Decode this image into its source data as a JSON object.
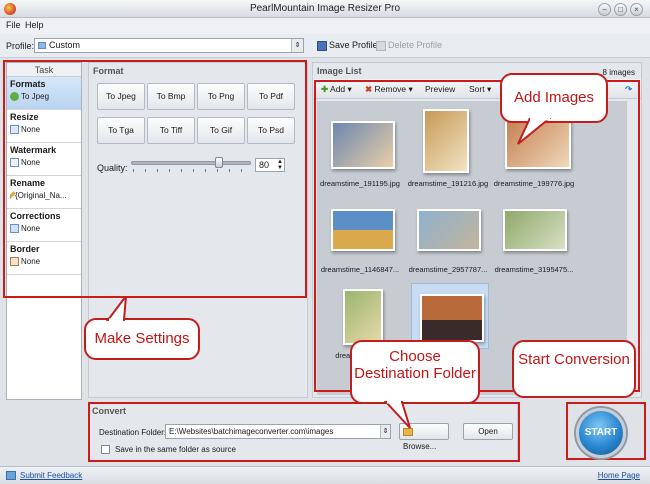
{
  "window": {
    "title": "PearlMountain Image Resizer Pro",
    "min": "–",
    "max": "□",
    "close": "×"
  },
  "menu": [
    "File",
    "Help"
  ],
  "profile": {
    "label": "Profile:",
    "value": "Custom",
    "save": "Save Profile",
    "delete": "Delete Profile"
  },
  "tasks": {
    "header": "Task",
    "items": [
      {
        "label": "Formats",
        "value": "To Jpeg"
      },
      {
        "label": "Resize",
        "value": "None"
      },
      {
        "label": "Watermark",
        "value": "None"
      },
      {
        "label": "Rename",
        "value": "{Original_Na..."
      },
      {
        "label": "Corrections",
        "value": "None"
      },
      {
        "label": "Border",
        "value": "None"
      }
    ]
  },
  "format": {
    "title": "Format",
    "buttons": [
      "To Jpeg",
      "To Bmp",
      "To Png",
      "To Pdf",
      "To Tga",
      "To Tiff",
      "To Gif",
      "To Psd"
    ],
    "quality_label": "Quality:",
    "quality_value": "80"
  },
  "image_list": {
    "title": "Image List",
    "count": "8 images",
    "add": "Add",
    "remove": "Remove",
    "preview": "Preview",
    "sort": "Sort",
    "images": [
      {
        "name": "dreamstime_191195.jpg",
        "colors": [
          "#6d86b0",
          "#e9cfa9"
        ]
      },
      {
        "name": "dreamstime_191216.jpg",
        "colors": [
          "#c99a57",
          "#f1e3c3"
        ]
      },
      {
        "name": "dreamstime_199776.jpg",
        "colors": [
          "#c27b4c",
          "#efd8b8"
        ]
      },
      {
        "name": "dreamstime_1146847...",
        "colors": [
          "#5c8fc8",
          "#d9a94b"
        ]
      },
      {
        "name": "dreamstime_2957787...",
        "colors": [
          "#8fb1d0",
          "#c2b49a"
        ]
      },
      {
        "name": "dreamstime_3195475...",
        "colors": [
          "#8fa86a",
          "#d7e0c3"
        ]
      },
      {
        "name": "dreamstime_...",
        "colors": [
          "#9bb56f",
          "#e6d9a8"
        ]
      },
      {
        "name": "",
        "colors": [
          "#b86a3a",
          "#3a2a2a"
        ]
      }
    ]
  },
  "convert": {
    "title": "Convert",
    "dest_label": "Destination Folder:",
    "dest_value": "E:\\Websites\\batchimageconverter.com\\images",
    "browse": "Browse...",
    "open": "Open",
    "same_folder": "Save in the same folder as source"
  },
  "start": "START",
  "status": {
    "feedback": "Submit Feedback",
    "homepage": "Home Page"
  },
  "callouts": {
    "add_images": "Add Images",
    "make_settings": "Make Settings",
    "destination": "Choose Destination Folder",
    "start": "Start Conversion"
  },
  "colors": {
    "accent": "#cc1b1b",
    "start_blue": "#2a86d0",
    "selected_task": "#c6dcf5"
  }
}
